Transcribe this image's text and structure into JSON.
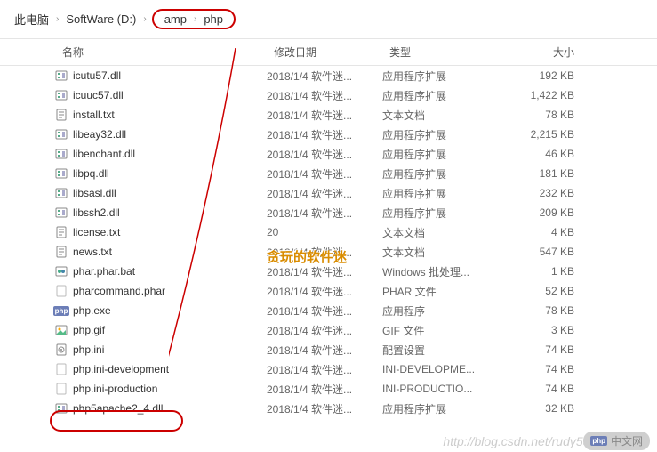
{
  "breadcrumb": {
    "pc": "此电脑",
    "drive": "SoftWare (D:)",
    "dir1": "amp",
    "dir2": "php"
  },
  "headers": {
    "name": "名称",
    "date": "修改日期",
    "type": "类型",
    "size": "大小"
  },
  "files": [
    {
      "icon": "dll",
      "name": "icutu57.dll",
      "date": "2018/1/4 软件迷...",
      "type": "应用程序扩展",
      "size": "192 KB"
    },
    {
      "icon": "dll",
      "name": "icuuc57.dll",
      "date": "2018/1/4 软件迷...",
      "type": "应用程序扩展",
      "size": "1,422 KB"
    },
    {
      "icon": "txt",
      "name": "install.txt",
      "date": "2018/1/4 软件迷...",
      "type": "文本文档",
      "size": "78 KB"
    },
    {
      "icon": "dll",
      "name": "libeay32.dll",
      "date": "2018/1/4 软件迷...",
      "type": "应用程序扩展",
      "size": "2,215 KB"
    },
    {
      "icon": "dll",
      "name": "libenchant.dll",
      "date": "2018/1/4 软件迷...",
      "type": "应用程序扩展",
      "size": "46 KB"
    },
    {
      "icon": "dll",
      "name": "libpq.dll",
      "date": "2018/1/4 软件迷...",
      "type": "应用程序扩展",
      "size": "181 KB"
    },
    {
      "icon": "dll",
      "name": "libsasl.dll",
      "date": "2018/1/4 软件迷...",
      "type": "应用程序扩展",
      "size": "232 KB"
    },
    {
      "icon": "dll",
      "name": "libssh2.dll",
      "date": "2018/1/4 软件迷...",
      "type": "应用程序扩展",
      "size": "209 KB"
    },
    {
      "icon": "txt",
      "name": "license.txt",
      "date": "20",
      "type": "文本文档",
      "size": "4 KB"
    },
    {
      "icon": "txt",
      "name": "news.txt",
      "date": "2018/1/4 软件迷...",
      "type": "文本文档",
      "size": "547 KB"
    },
    {
      "icon": "bat",
      "name": "phar.phar.bat",
      "date": "2018/1/4 软件迷...",
      "type": "Windows 批处理...",
      "size": "1 KB"
    },
    {
      "icon": "file",
      "name": "pharcommand.phar",
      "date": "2018/1/4 软件迷...",
      "type": "PHAR 文件",
      "size": "52 KB"
    },
    {
      "icon": "php",
      "name": "php.exe",
      "date": "2018/1/4 软件迷...",
      "type": "应用程序",
      "size": "78 KB"
    },
    {
      "icon": "gif",
      "name": "php.gif",
      "date": "2018/1/4 软件迷...",
      "type": "GIF 文件",
      "size": "3 KB"
    },
    {
      "icon": "ini",
      "name": "php.ini",
      "date": "2018/1/4 软件迷...",
      "type": "配置设置",
      "size": "74 KB"
    },
    {
      "icon": "file",
      "name": "php.ini-development",
      "date": "2018/1/4 软件迷...",
      "type": "INI-DEVELOPME...",
      "size": "74 KB"
    },
    {
      "icon": "file",
      "name": "php.ini-production",
      "date": "2018/1/4 软件迷...",
      "type": "INI-PRODUCTIO...",
      "size": "74 KB"
    },
    {
      "icon": "dll",
      "name": "php5apache2_4.dll",
      "date": "2018/1/4 软件迷...",
      "type": "应用程序扩展",
      "size": "32 KB"
    }
  ],
  "overlay": "贪玩的软件迷",
  "watermark": "http://blog.csdn.net/rudy5348",
  "phpcn_prefix": "php",
  "phpcn_text": "中文网"
}
